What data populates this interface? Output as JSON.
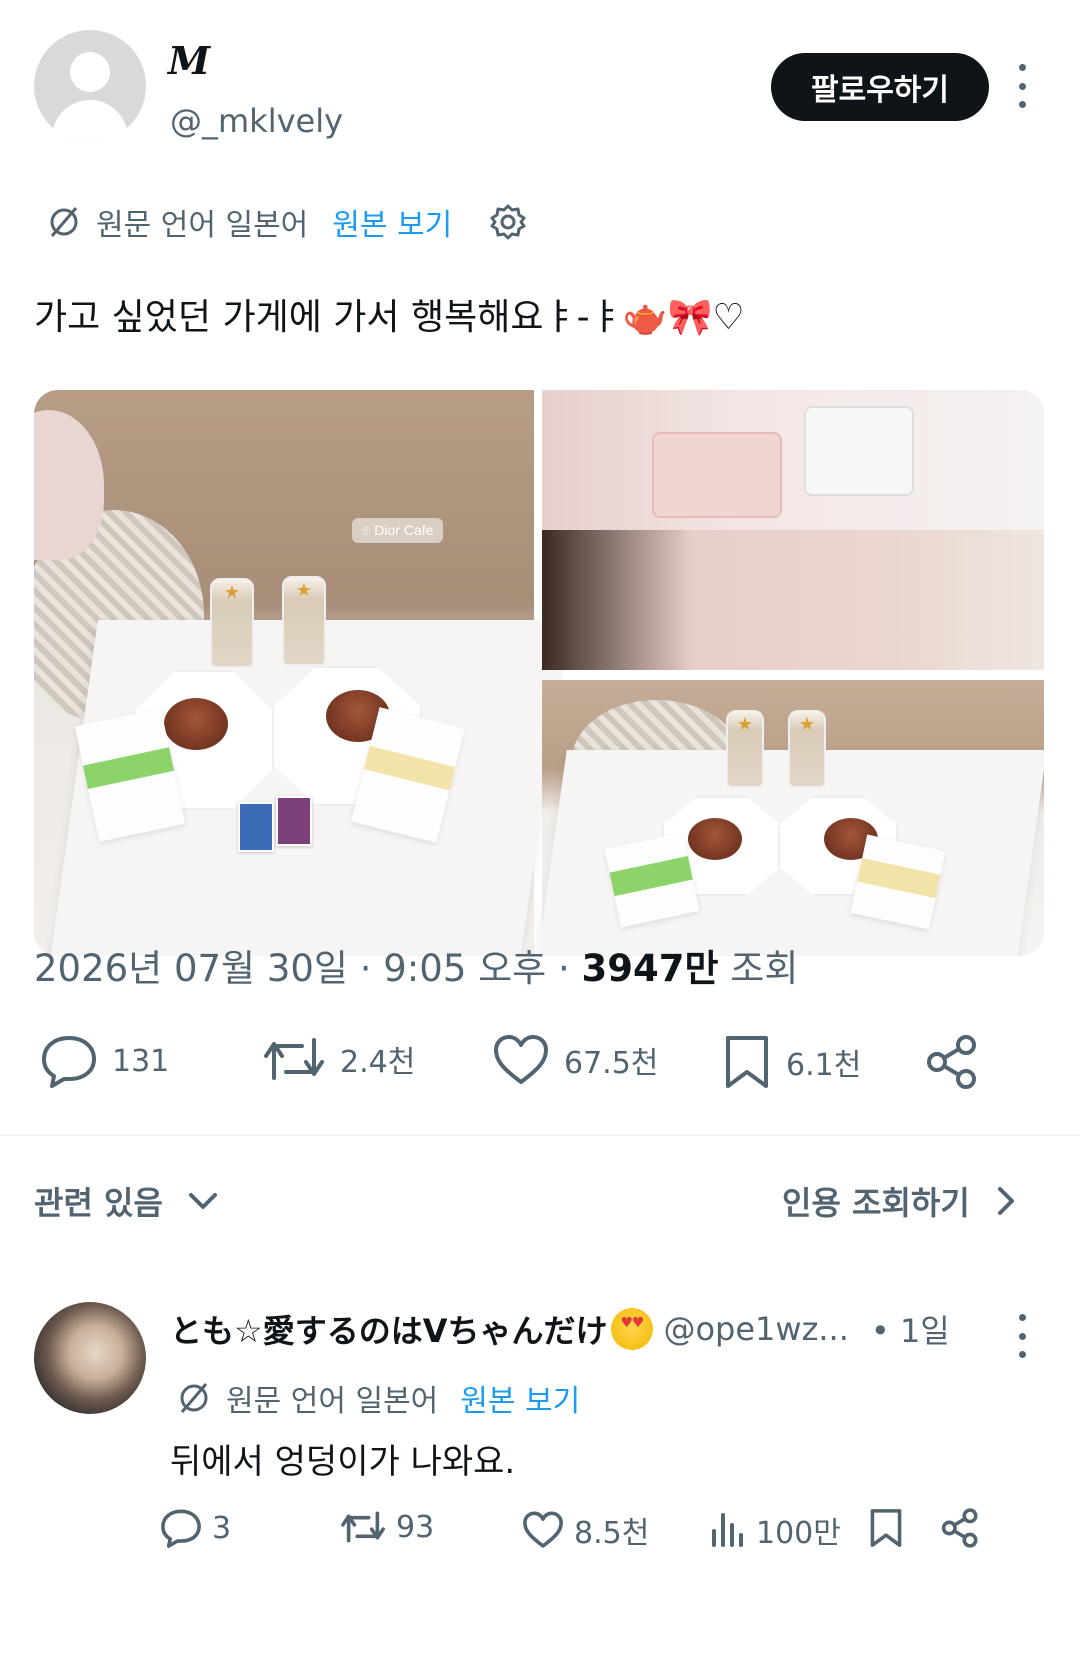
{
  "post": {
    "author_display_name": "M",
    "author_handle": "@_mklvely",
    "follow_label": "팔로우하기",
    "translation": {
      "label": "원문 언어 일본어",
      "show_original": "원본 보기"
    },
    "text": "가고 싶었던 가게에 가서 행복해요ㅑ-ㅑ🫖🎀♡",
    "media": {
      "location_tag": "Dior Cafe"
    },
    "date": "2026년 07월 30일",
    "time": "9:05 오후",
    "views_count": "3947만",
    "views_label": "조회",
    "stats": {
      "replies": "131",
      "reposts": "2.4천",
      "likes": "67.5천",
      "bookmarks": "6.1천"
    }
  },
  "related": {
    "label": "관련 있음",
    "quotes_label": "인용 조회하기"
  },
  "reply": {
    "display_name": "とも☆愛するのはVちゃんだけ",
    "handle": "@ope1wz...",
    "time": "• 1일",
    "translation": {
      "label": "원문 언어 일본어",
      "show_original": "원본 보기"
    },
    "text": "뒤에서 엉덩이가 나와요.",
    "stats": {
      "replies": "3",
      "reposts": "93",
      "likes": "8.5천",
      "views": "100만"
    }
  },
  "colors": {
    "text": "#0f1419",
    "secondary": "#536471",
    "accent": "#1d9bf0",
    "button_bg": "#0f1419"
  },
  "icons": [
    "more-vertical-icon",
    "translate-icon",
    "gear-icon",
    "reply-icon",
    "repost-icon",
    "like-icon",
    "bookmark-icon",
    "share-icon",
    "chevron-down-icon",
    "chevron-right-icon",
    "views-icon",
    "location-icon"
  ]
}
